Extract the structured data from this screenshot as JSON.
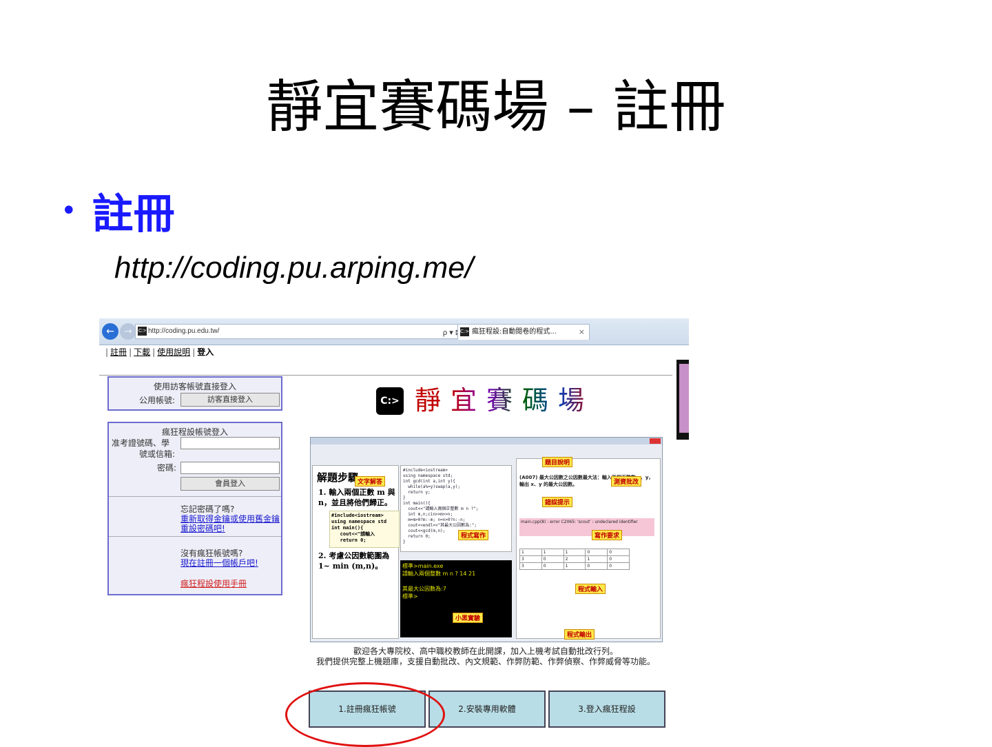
{
  "slide": {
    "title": "靜宜賽碼場 – 註冊",
    "bullet": "註冊",
    "url": "http://coding.pu.arping.me/"
  },
  "browser": {
    "address": "http://coding.pu.edu.tw/",
    "address_tools": "ρ ▾ ⊠ C",
    "tab_label": "瘋狂程設:自動閱卷的程式...",
    "tab_close": "×",
    "icons": [
      "back-arrow-icon",
      "forward-arrow-icon",
      "site-logo-icon"
    ]
  },
  "site_menu": {
    "items": [
      "註冊",
      "下載",
      "使用說明"
    ],
    "current": "登入",
    "separator": "|"
  },
  "guest_panel": {
    "title": "使用訪客帳號直接登入",
    "label": "公用帳號:",
    "button": "訪客直接登入"
  },
  "login_panel": {
    "title": "瘋狂程設帳號登入",
    "id_label_1": "准考證號碼、學",
    "id_label_2": "號或信箱:",
    "pw_label": "密碼:",
    "login_button": "會員登入",
    "forgot_q": "忘記密碼了嗎?",
    "forgot_link_1": "重新取得金鑰或使用舊金鑰",
    "forgot_link_2": "重設密碼吧!",
    "noacct_q": "沒有瘋狂帳號嗎?",
    "register_link": "現在註冊一個帳戶吧!",
    "manual_link": "瘋狂程設使用手冊"
  },
  "logo": {
    "icon_text": "C:>",
    "name": "靜宜賽碼場"
  },
  "ide": {
    "left_heading": "解題步驟",
    "step1": "1. 輸入兩個正數 m 與 n，並且將他們歸正。",
    "step2": "2. 考慮公因數範圍為 1~ min (m,n)。",
    "code_snippet": "#include<iostream>\nusing namespace std\nint main(){\n   cout<<\"請輸入\n   return 0;",
    "code_editor": "#include<iostream>\nusing namespace std;\nint gcd(int a,int y){\n  while(a%=y)swap(a,y);\n  return y;\n}\nint main(){\n  cout<<\"請輸入兩個正整數 m n ?\";\n  int m,n;cin>>m>>n;\n  m=m>0?m:-m; n=n>0?n:-n;\n  cout<<endl<<\"其最大公因數為:\";\n  cout<<gcd(m,n);\n  return 0;\n}",
    "terminal": "標準>main.exe\n請輸入兩個整數 m n ? 14 21\n\n其最大公因數為:7\n標準>",
    "problem": "(A007) 最大公因數之公因數最大法：輸入兩個正整數 x、y，輸出 x、y 的最大公因數。",
    "error_text": "main.cpp(8) : error C2065: 'scout' : undeclared identifier",
    "tags": {
      "explain": "文字解答",
      "problem": "題目說明",
      "grade": "測資批改",
      "error": "錯誤提示",
      "write": "程式寫作",
      "requirement": "寫作要求",
      "input": "程式輸入",
      "console": "小黑實驗",
      "output": "程式輸出"
    }
  },
  "welcome": {
    "line1": "歡迎各大專院校、高中職校教師在此開課，加入上機考試自動批改行列。",
    "line2": "我們提供完整上機題庫，支援自動批改、內文規範、作弊防範、作弊偵察、作弊威脅等功能。"
  },
  "buttons": {
    "register": "1.註冊瘋狂帳號",
    "install": "2.安裝專用軟體",
    "login": "3.登入瘋狂程設"
  },
  "colors": {
    "bullet_blue": "#1a1aff",
    "highlight_red": "#e01010",
    "panel_border": "#6b6bcf",
    "button_fill": "#b8dde6"
  }
}
